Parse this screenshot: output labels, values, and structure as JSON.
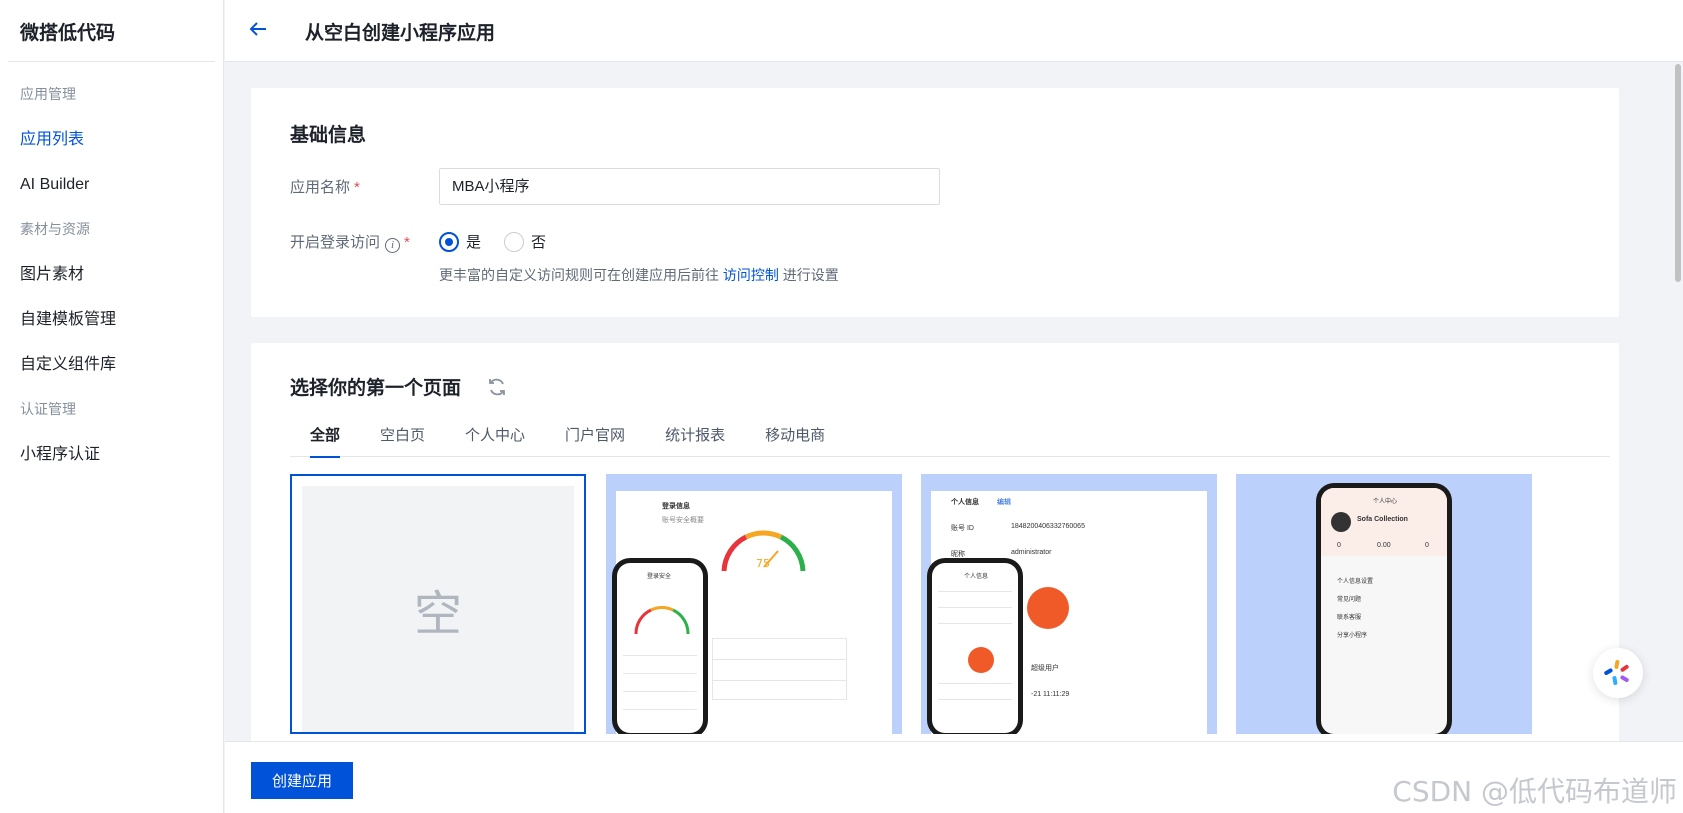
{
  "sidebar": {
    "brand": "微搭低代码",
    "items": [
      {
        "label": "应用管理",
        "type": "group"
      },
      {
        "label": "应用列表",
        "type": "item",
        "active": true
      },
      {
        "label": "AI Builder",
        "type": "item"
      },
      {
        "label": "素材与资源",
        "type": "group"
      },
      {
        "label": "图片素材",
        "type": "item"
      },
      {
        "label": "自建模板管理",
        "type": "item"
      },
      {
        "label": "自定义组件库",
        "type": "item"
      },
      {
        "label": "认证管理",
        "type": "group"
      },
      {
        "label": "小程序认证",
        "type": "item"
      }
    ]
  },
  "header": {
    "title": "从空白创建小程序应用"
  },
  "basic": {
    "title": "基础信息",
    "name_label": "应用名称",
    "name_value": "MBA小程序",
    "login_label": "开启登录访问",
    "radio_yes": "是",
    "radio_no": "否",
    "selected": "是",
    "hint_prefix": "更丰富的自定义访问规则可在创建应用后前往",
    "hint_link": "访问控制",
    "hint_suffix": "进行设置"
  },
  "pages": {
    "title": "选择你的第一个页面",
    "tabs": [
      "全部",
      "空白页",
      "个人中心",
      "门户官网",
      "统计报表",
      "移动电商"
    ],
    "active_tab": "全部",
    "blank_label": "空",
    "tpl2": {
      "heading": "登录信息",
      "subheading": "账号安全概要",
      "gauge_value": "75",
      "phone_title": "登录安全"
    },
    "tpl3": {
      "heading": "个人信息",
      "edit": "编辑",
      "id_label": "账号 ID",
      "id_value": "1848200406332760065",
      "nick_label": "昵称",
      "nick_value": "administrator",
      "role_text": "超级用户",
      "date_text": "-21 11:11:29",
      "phone_title": "个人信息"
    },
    "tpl4": {
      "phone_title": "个人中心",
      "user": "Sofa Collection",
      "stats": [
        "0",
        "0.00",
        "0"
      ],
      "menu": [
        "个人信息设置",
        "常见问题",
        "联系客服",
        "分享小程序"
      ]
    }
  },
  "footer": {
    "create_label": "创建应用",
    "watermark": "CSDN @低代码布道师"
  },
  "colors": {
    "primary": "#0052d9",
    "required": "#e34d59",
    "template_bg": "#bcd0fc"
  }
}
